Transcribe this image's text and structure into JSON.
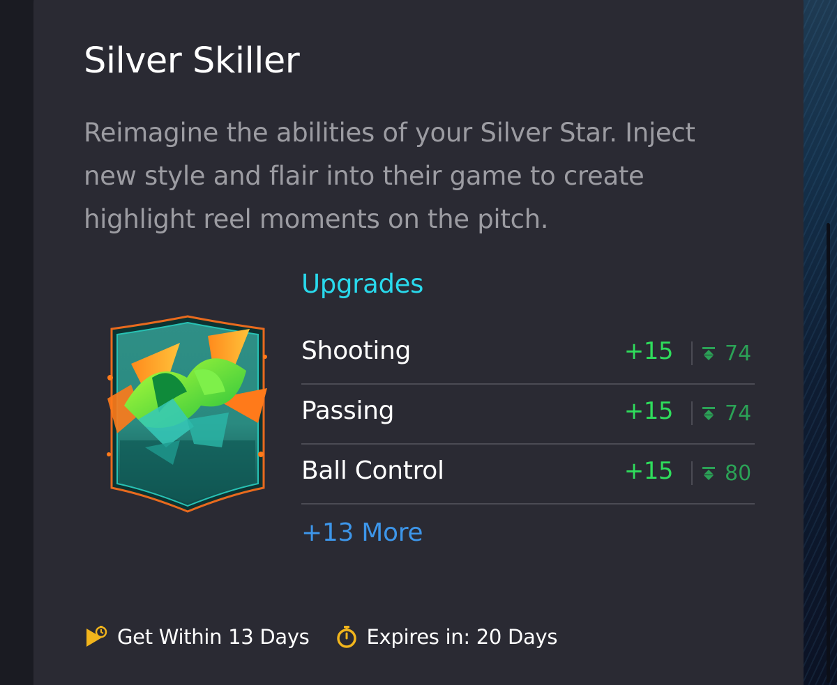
{
  "card": {
    "title": "Silver Skiller",
    "description": "Reimagine the abilities of your Silver Star. Inject new style and flair into their game to create highlight reel moments on the pitch.",
    "upgrades_heading": "Upgrades",
    "upgrades": [
      {
        "name": "Shooting",
        "boost": "+15",
        "cap": "74"
      },
      {
        "name": "Passing",
        "boost": "+15",
        "cap": "74"
      },
      {
        "name": "Ball Control",
        "boost": "+15",
        "cap": "80"
      }
    ],
    "more_link": "+13 More",
    "footer": {
      "get_within": "Get Within 13 Days",
      "expires": "Expires in: 20 Days"
    }
  },
  "icons": {
    "get_within": "play-clock-icon",
    "expires": "stopwatch-icon",
    "cap": "max-cap-icon"
  },
  "colors": {
    "card_bg": "#2a2a33",
    "accent_cyan": "#29d9ec",
    "boost_green": "#2fdd5c",
    "cap_green": "#2ba156",
    "link_blue": "#3d96ea",
    "icon_yellow": "#f2b51c"
  }
}
